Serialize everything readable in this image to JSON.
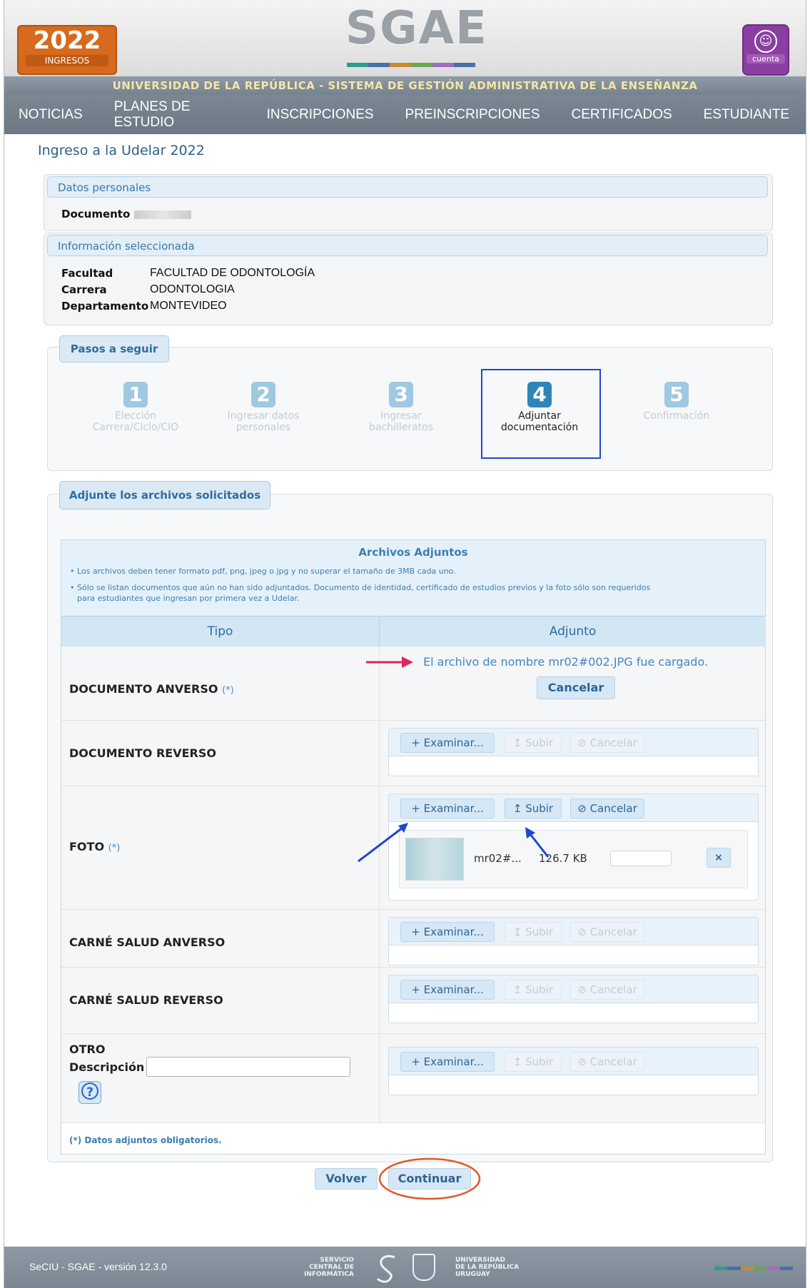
{
  "header": {
    "year": "2022",
    "year_label": "INGRESOS",
    "app_name": "SGAE",
    "account_label": "cuenta",
    "university": "UNIVERSIDAD DE LA REPÚBLICA - SISTEMA DE GESTIÓN ADMINISTRATIVA DE LA ENSEÑANZA",
    "bar_colors": [
      "#2a9d8f",
      "#4a6fa5",
      "#c8892f",
      "#6aa84f",
      "#a06cc0",
      "#4a6fa5"
    ]
  },
  "nav": {
    "items": [
      "NOTICIAS",
      "PLANES DE ESTUDIO",
      "INSCRIPCIONES",
      "PREINSCRIPCIONES",
      "CERTIFICADOS",
      "ESTUDIANTE"
    ]
  },
  "page": {
    "title": "Ingreso a la Udelar 2022"
  },
  "personal": {
    "heading": "Datos personales",
    "doc_label": "Documento"
  },
  "selected": {
    "heading": "Información seleccionada",
    "rows": [
      {
        "k": "Facultad",
        "v": "FACULTAD DE ODONTOLOGÍA"
      },
      {
        "k": "Carrera",
        "v": "ODONTOLOGIA"
      },
      {
        "k": "Departamento",
        "v": "MONTEVIDEO"
      }
    ]
  },
  "steps": {
    "heading": "Pasos a seguir",
    "items": [
      {
        "n": "1",
        "l1": "Elección",
        "l2": "Carrera/Ciclo/CIO"
      },
      {
        "n": "2",
        "l1": "Ingresar datos",
        "l2": "personales"
      },
      {
        "n": "3",
        "l1": "Ingresar",
        "l2": "bachilleratos"
      },
      {
        "n": "4",
        "l1": "Adjuntar",
        "l2": "documentación"
      },
      {
        "n": "5",
        "l1": "Confirmación",
        "l2": ""
      }
    ],
    "active": 4
  },
  "attach": {
    "heading": "Adjunte los archivos solicitados",
    "title": "Archivos Adjuntos",
    "note1": "• Los archivos deben tener formato pdf, png, jpeg o jpg y no superar el tamaño de 3MB cada uno.",
    "note2": "• Sólo se listan documentos que aún no han sido adjuntados. Documento de identidad, certificado de estudios previos y la foto sólo son requeridos",
    "note3": "para estudiantes que ingresan por primera vez a Udelar.",
    "col_tipo": "Tipo",
    "col_adjunto": "Adjunto",
    "req_mark": "(*)",
    "uploaded_msg": "El archivo de nombre mr02#002.JPG fue cargado.",
    "cancel_label": "Cancelar",
    "examinar": "+ Examinar...",
    "subir": "↥ Subir",
    "cancelar": "⊘ Cancelar",
    "rows": [
      "DOCUMENTO ANVERSO",
      "DOCUMENTO REVERSO",
      "FOTO",
      "CARNÉ SALUD ANVERSO",
      "CARNÉ SALUD REVERSO"
    ],
    "otro": "OTRO",
    "descripcion": "Descripción",
    "file_name": "mr02#...",
    "file_size": "126.7 KB",
    "remove": "×",
    "footnote": "(*) Datos adjuntos obligatorios."
  },
  "actions": {
    "volver": "Volver",
    "continuar": "Continuar"
  },
  "footer": {
    "version": "SeCIU - SGAE - versión 12.3.0",
    "servicio": [
      "SERVICIO",
      "CENTRAL DE",
      "INFORMÁTICA"
    ],
    "udelar": [
      "UNIVERSIDAD",
      "DE LA REPÚBLICA",
      "URUGUAY"
    ]
  }
}
